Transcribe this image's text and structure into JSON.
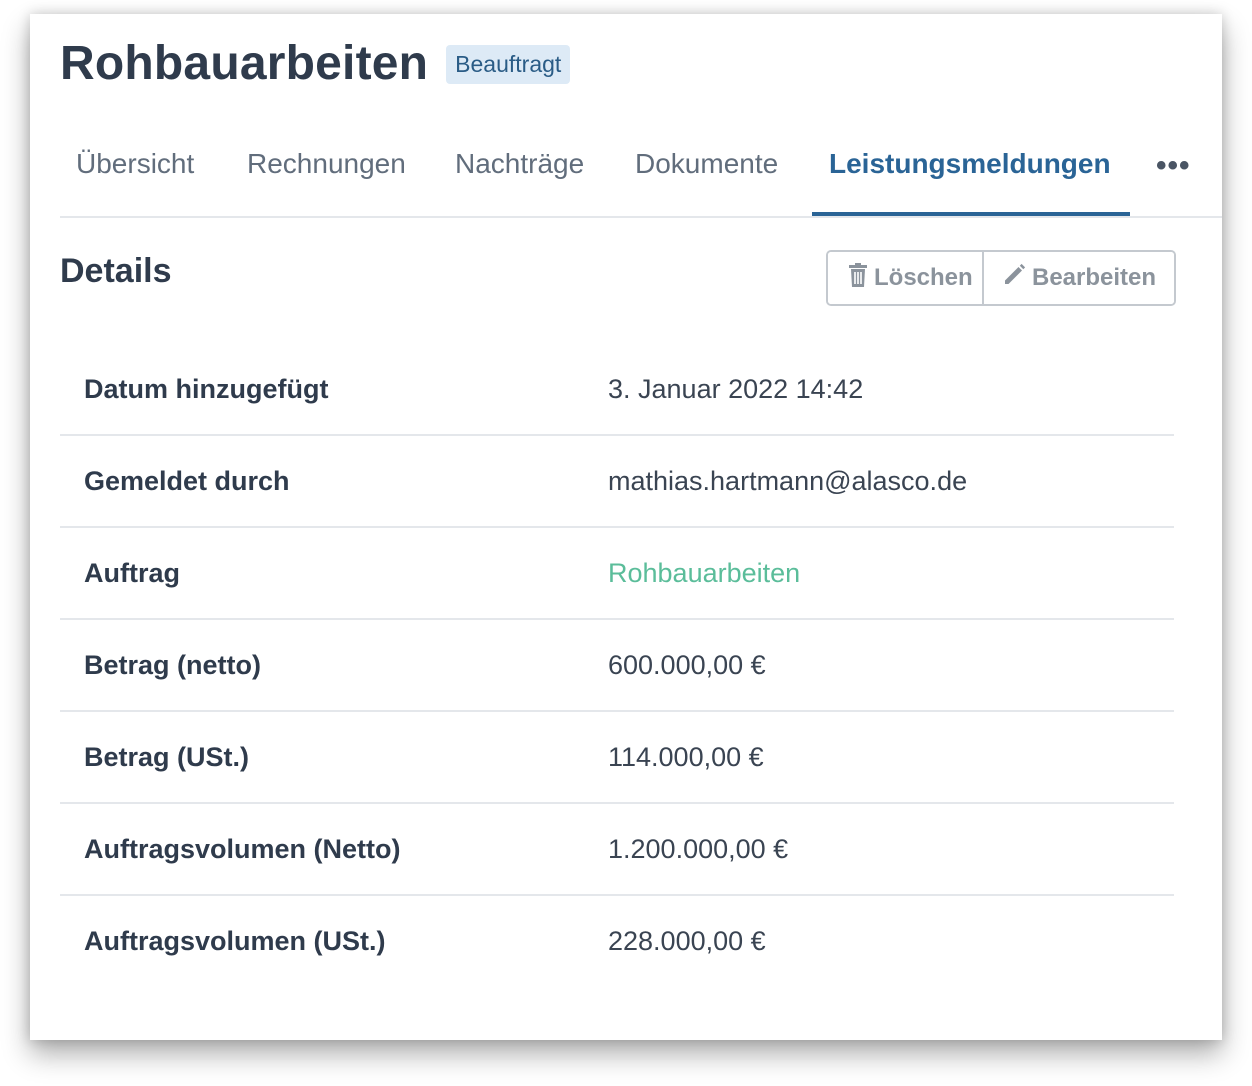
{
  "header": {
    "title": "Rohbauarbeiten",
    "status_badge": "Beauftragt"
  },
  "tabs": [
    {
      "label": "Übersicht",
      "active": false
    },
    {
      "label": "Rechnungen",
      "active": false
    },
    {
      "label": "Nachträge",
      "active": false
    },
    {
      "label": "Dokumente",
      "active": false
    },
    {
      "label": "Leistungsmeldungen",
      "active": true
    }
  ],
  "tabs_more_label": "•••",
  "details": {
    "title": "Details",
    "delete_label": "Löschen",
    "edit_label": "Bearbeiten",
    "rows": [
      {
        "label": "Datum hinzugefügt",
        "value": "3. Januar 2022 14:42"
      },
      {
        "label": "Gemeldet durch",
        "value": "mathias.hartmann@alasco.de"
      },
      {
        "label": "Auftrag",
        "value": "Rohbauarbeiten"
      },
      {
        "label": "Betrag (netto)",
        "value": "600.000,00 €"
      },
      {
        "label": "Betrag (USt.)",
        "value": "114.000,00 €"
      },
      {
        "label": "Auftragsvolumen (Netto)",
        "value": "1.200.000,00 €"
      },
      {
        "label": "Auftragsvolumen (USt.)",
        "value": "228.000,00 €"
      }
    ]
  },
  "colors": {
    "accent": "#2a6496",
    "badge_bg": "#ddeaf6",
    "link": "#5bbd9a",
    "text": "#2f3b4c"
  }
}
